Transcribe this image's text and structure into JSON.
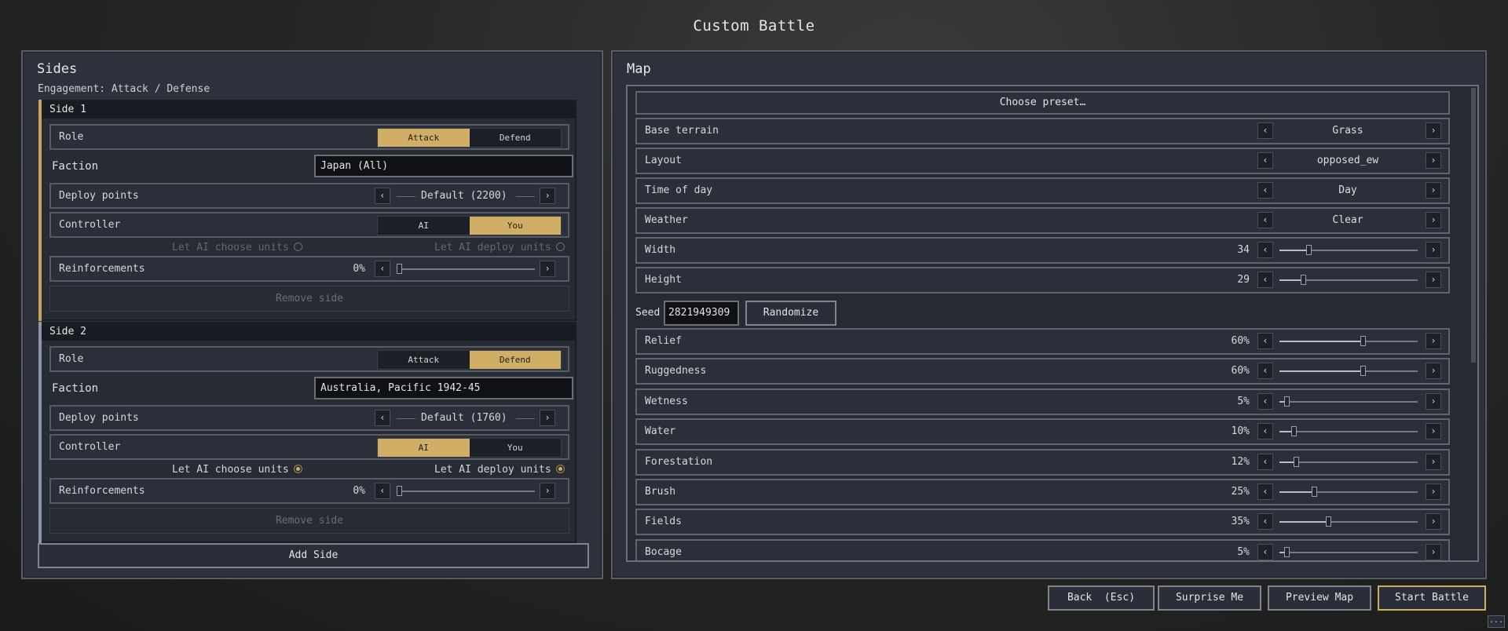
{
  "window": {
    "title": "Custom Battle"
  },
  "sides_panel": {
    "title": "Sides",
    "engagement": "Engagement: Attack / Defense",
    "sides": [
      {
        "name": "Side 1",
        "stripe_color": "#c9a55a",
        "role_label": "Role",
        "role_options": [
          "Attack",
          "Defend"
        ],
        "role_selected": "Attack",
        "faction_label": "Faction",
        "faction_value": "Japan (All)",
        "deploy_label": "Deploy points",
        "deploy_value": "Default (2200)",
        "controller_label": "Controller",
        "controller_options": [
          "AI",
          "You"
        ],
        "controller_selected": "You",
        "ai_choose_units": "Let AI choose units",
        "ai_deploy_units": "Let AI deploy units",
        "reinforcements_label": "Reinforcements",
        "reinforcements_value": "0%",
        "remove_label": "Remove side"
      },
      {
        "name": "Side 2",
        "stripe_color": "#8e95a8",
        "role_label": "Role",
        "role_options": [
          "Attack",
          "Defend"
        ],
        "role_selected": "Defend",
        "faction_label": "Faction",
        "faction_value": "Australia, Pacific 1942-45",
        "deploy_label": "Deploy points",
        "deploy_value": "Default (1760)",
        "controller_label": "Controller",
        "controller_options": [
          "AI",
          "You"
        ],
        "controller_selected": "AI",
        "ai_choose_units": "Let AI choose units",
        "ai_deploy_units": "Let AI deploy units",
        "reinforcements_label": "Reinforcements",
        "reinforcements_value": "0%",
        "remove_label": "Remove side"
      }
    ],
    "add_side_label": "Add Side"
  },
  "map_panel": {
    "title": "Map",
    "choose_preset_label": "Choose preset…",
    "base_terrain": {
      "label": "Base terrain",
      "value": "Grass"
    },
    "layout": {
      "label": "Layout",
      "value": "opposed_ew"
    },
    "time_of_day": {
      "label": "Time of day",
      "value": "Day"
    },
    "weather": {
      "label": "Weather",
      "value": "Clear"
    },
    "width": {
      "label": "Width",
      "value": "34",
      "fill": 0.21
    },
    "height": {
      "label": "Height",
      "value": "29",
      "fill": 0.17
    },
    "seed": {
      "label": "Seed",
      "value": "2821949309",
      "randomize_label": "Randomize"
    },
    "sliders": [
      {
        "label": "Relief",
        "value": "60%",
        "fill": 0.6
      },
      {
        "label": "Ruggedness",
        "value": "60%",
        "fill": 0.6
      },
      {
        "label": "Wetness",
        "value": "5%",
        "fill": 0.05
      },
      {
        "label": "Water",
        "value": "10%",
        "fill": 0.1
      },
      {
        "label": "Forestation",
        "value": "12%",
        "fill": 0.12
      },
      {
        "label": "Brush",
        "value": "25%",
        "fill": 0.25
      },
      {
        "label": "Fields",
        "value": "35%",
        "fill": 0.35
      },
      {
        "label": "Bocage",
        "value": "5%",
        "fill": 0.05
      }
    ]
  },
  "footer": {
    "back_label": "Back  (Esc)",
    "surprise_label": "Surprise Me",
    "preview_label": "Preview Map",
    "start_label": "Start Battle",
    "corner_label": "..."
  },
  "colors": {
    "accent": "#d1ae66",
    "panel": "#2c313c",
    "border": "#5a5e66"
  },
  "icons": {
    "arrow_left": "chevron-left-icon",
    "arrow_right": "chevron-right-icon"
  }
}
